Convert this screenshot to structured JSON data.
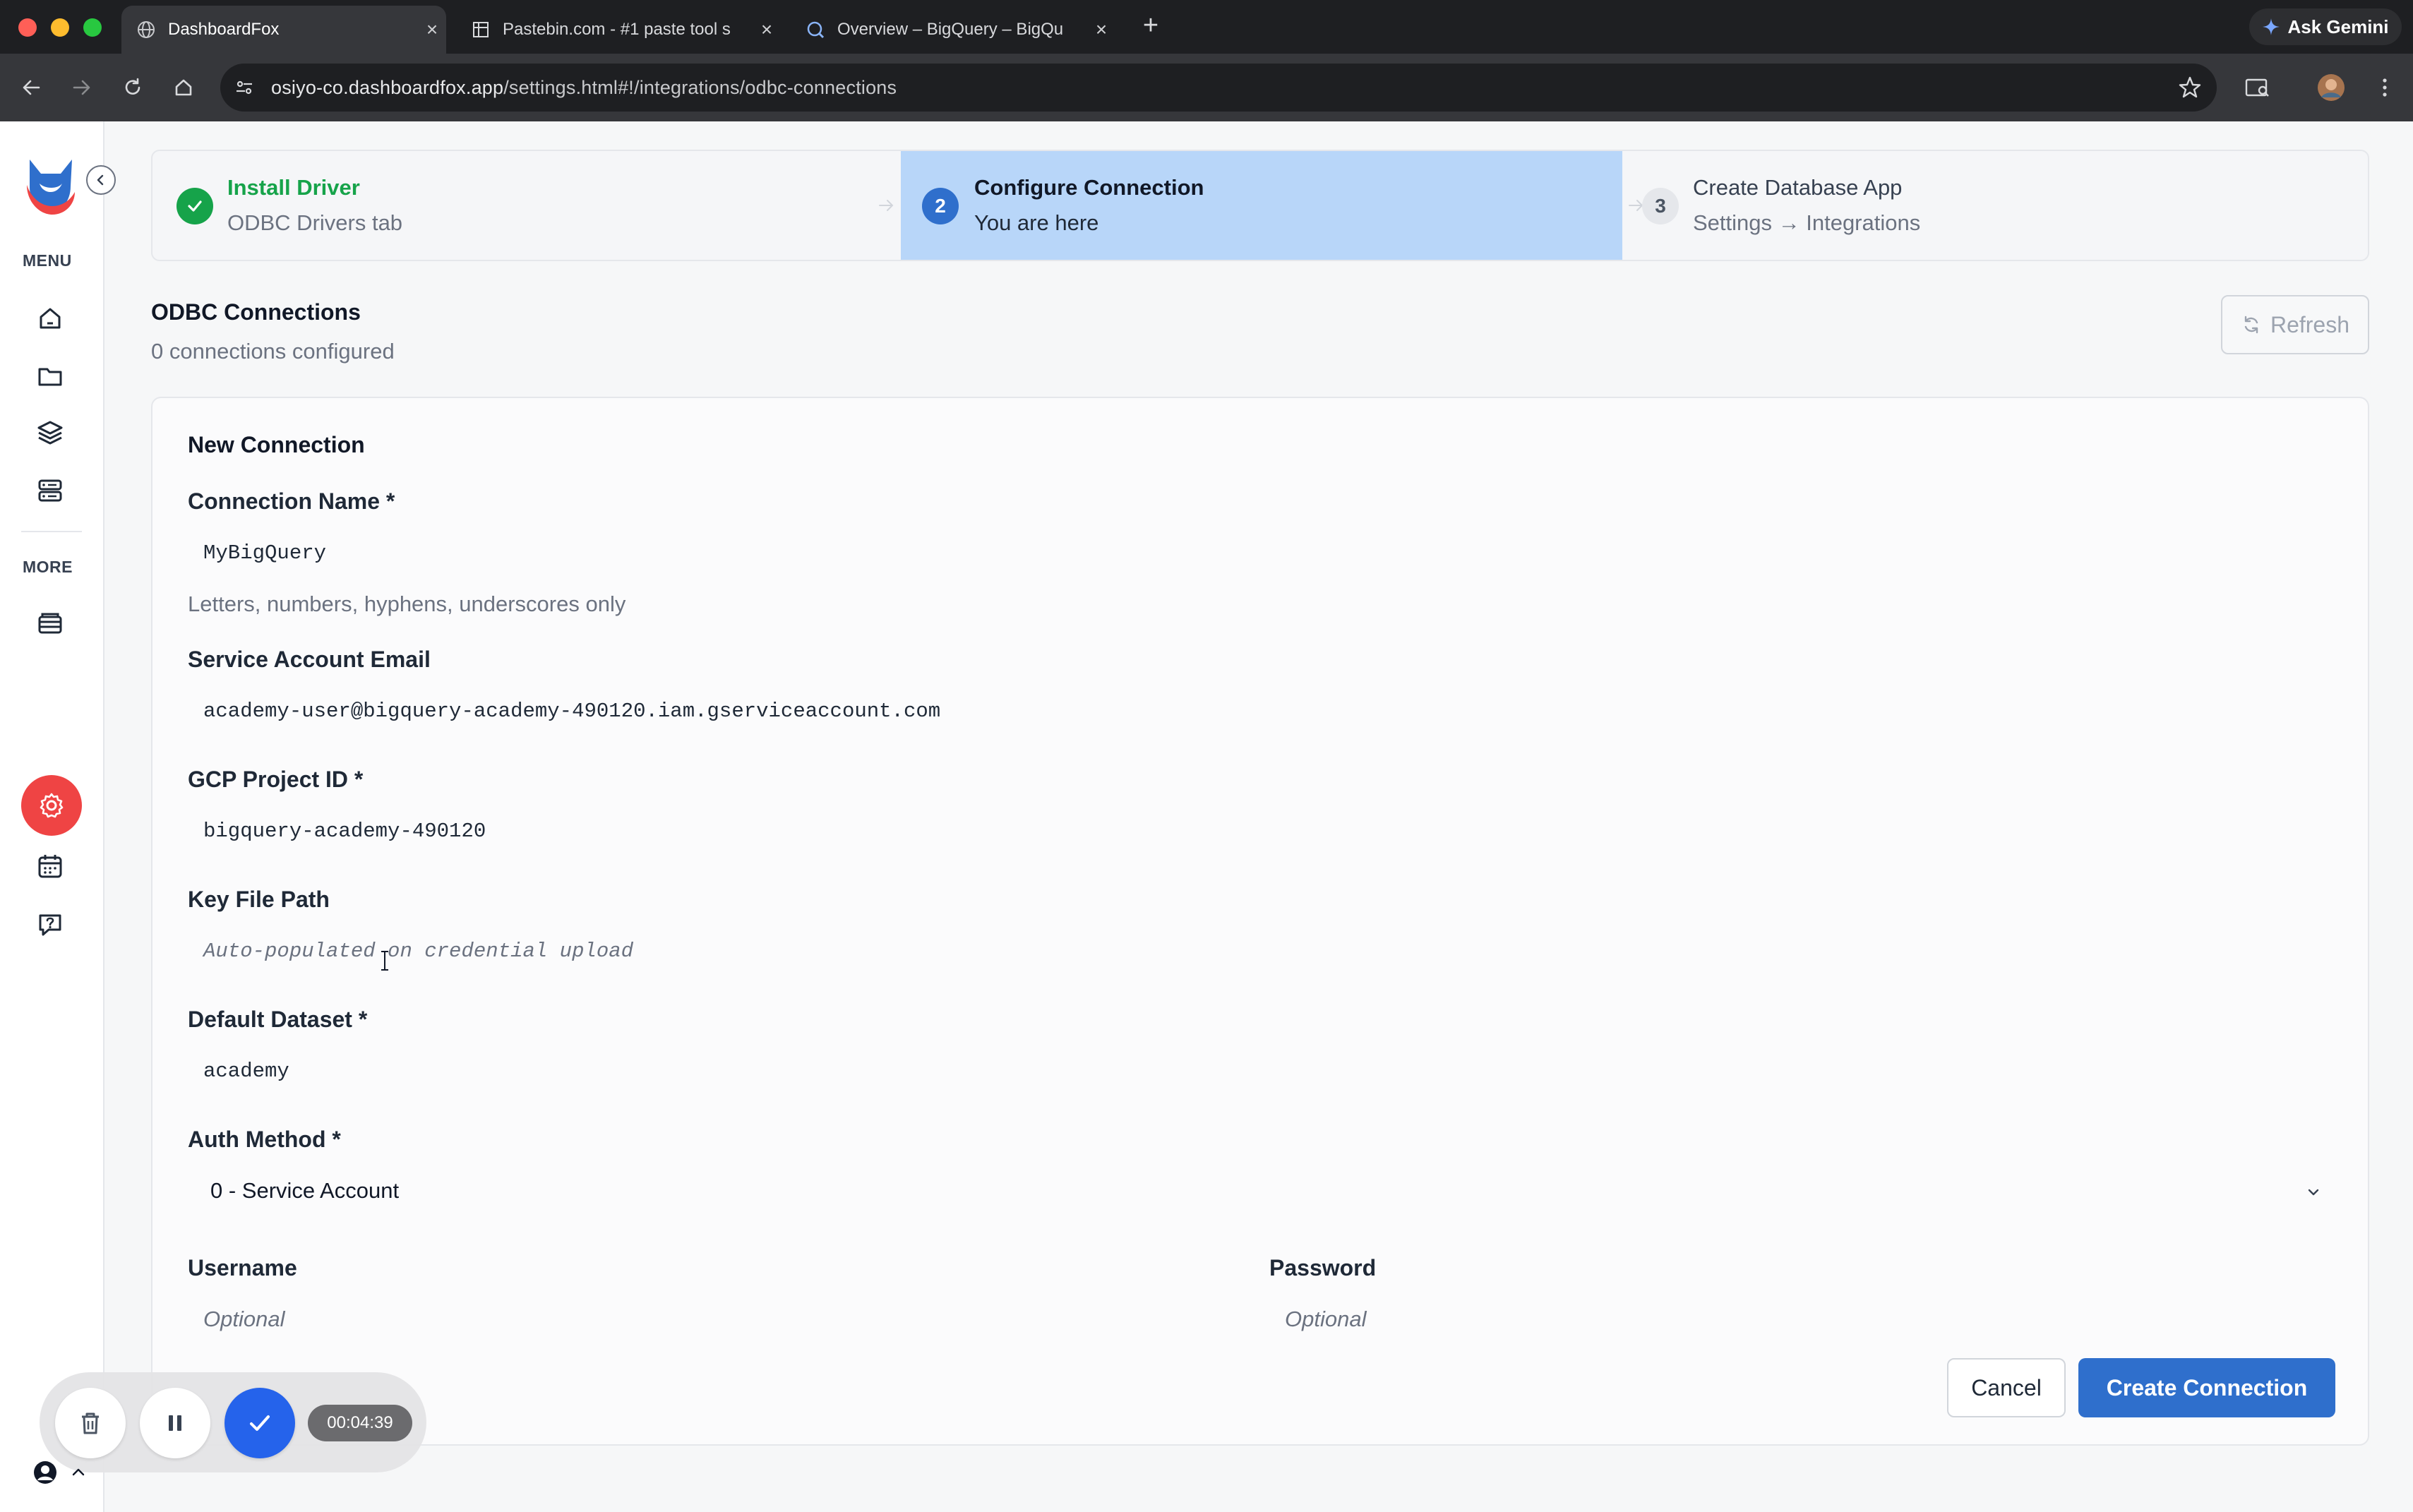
{
  "browser": {
    "tabs": [
      {
        "title": "DashboardFox",
        "active": true
      },
      {
        "title": "Pastebin.com - #1 paste tool s",
        "active": false
      },
      {
        "title": "Overview – BigQuery – BigQu",
        "active": false
      }
    ],
    "new_tab": "+",
    "ask_gemini": "Ask Gemini",
    "url_host": "osiyo-co.dashboardfox.app",
    "url_path": "/settings.html#!/integrations/odbc-connections"
  },
  "sidebar": {
    "menu_label": "MENU",
    "more_label": "MORE",
    "menu_icons": [
      "home-icon",
      "folder-icon",
      "layers-icon",
      "server-icon"
    ],
    "more_icons": [
      "database-icon",
      "settings-icon",
      "calendar-icon",
      "help-icon"
    ],
    "active_icon": "settings-icon",
    "accent_color": "#ef4444"
  },
  "stepper": {
    "steps": [
      {
        "number": "1",
        "title": "Install Driver",
        "subtitle": "ODBC Drivers tab",
        "state": "complete"
      },
      {
        "number": "2",
        "title": "Configure Connection",
        "subtitle": "You are here",
        "state": "current"
      },
      {
        "number": "3",
        "title": "Create Database App",
        "subtitle": "Settings → Integrations",
        "state": "upcoming"
      }
    ]
  },
  "header": {
    "title": "ODBC Connections",
    "subtitle": "0 connections configured",
    "refresh_label": "Refresh"
  },
  "form": {
    "title": "New Connection",
    "connection_name": {
      "label": "Connection Name *",
      "value": "MyBigQuery",
      "hint": "Letters, numbers, hyphens, underscores only"
    },
    "service_account_email": {
      "label": "Service Account Email",
      "value": "academy-user@bigquery-academy-490120.iam.gserviceaccount.com"
    },
    "gcp_project_id": {
      "label": "GCP Project ID *",
      "value": "bigquery-academy-490120"
    },
    "key_file_path": {
      "label": "Key File Path",
      "placeholder": "Auto-populated on credential upload"
    },
    "default_dataset": {
      "label": "Default Dataset *",
      "value": "academy"
    },
    "auth_method": {
      "label": "Auth Method *",
      "selected": "0 - Service Account"
    },
    "username": {
      "label": "Username",
      "placeholder": "Optional"
    },
    "password": {
      "label": "Password",
      "placeholder": "Optional"
    },
    "cancel_label": "Cancel",
    "submit_label": "Create Connection",
    "primary_color": "#2f6fcc"
  },
  "recorder": {
    "elapsed": "00:04:39"
  }
}
